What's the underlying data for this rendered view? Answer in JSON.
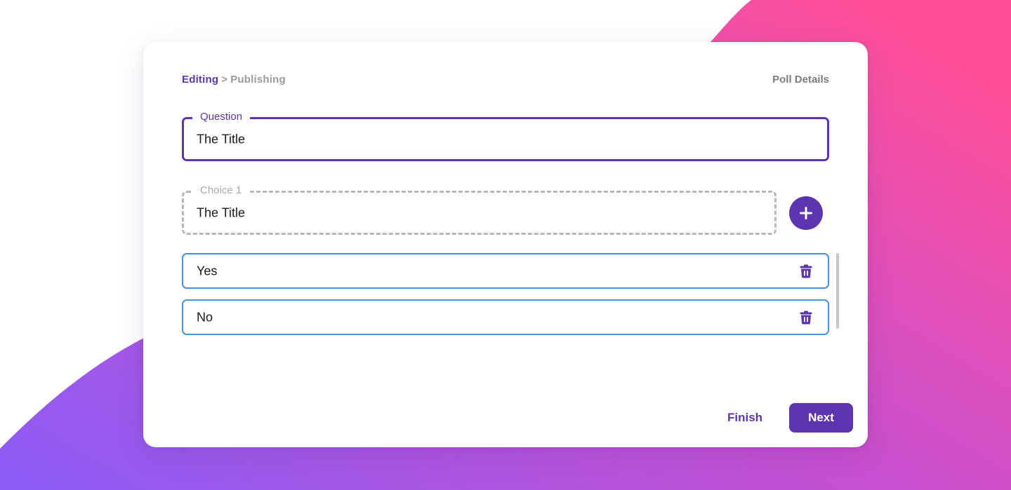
{
  "colors": {
    "accent": "#5e35b1",
    "answer_border": "#4a90d9",
    "gradient_start": "#8b5cf6",
    "gradient_end": "#ff4f9a"
  },
  "breadcrumb": {
    "current": "Editing",
    "separator": ">",
    "next": "Publishing"
  },
  "header": {
    "poll_details": "Poll Details"
  },
  "question": {
    "label": "Question",
    "value": "The Title"
  },
  "choice": {
    "label": "Choice 1",
    "value": "The Title",
    "add_icon": "plus-icon"
  },
  "answers": [
    {
      "text": "Yes",
      "icon": "trash-icon"
    },
    {
      "text": "No",
      "icon": "trash-icon"
    }
  ],
  "actions": {
    "finish_label": "Finish",
    "next_label": "Next"
  }
}
